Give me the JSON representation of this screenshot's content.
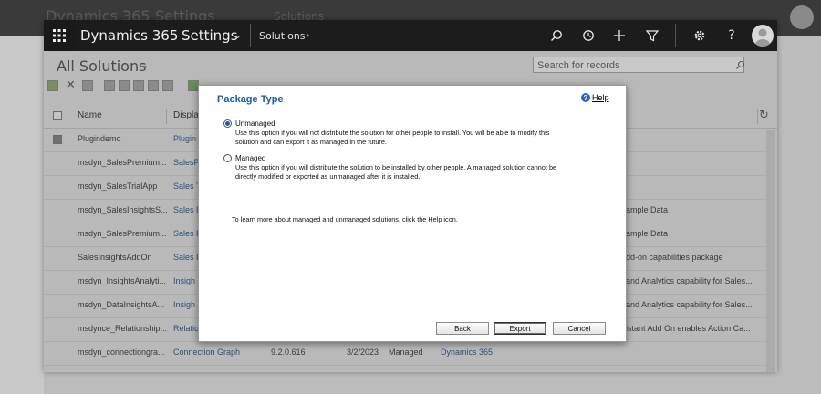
{
  "outer": {
    "title_ghost": "Dynamics 365",
    "settings_ghost": "Settings",
    "crumb_ghost": "Solutions"
  },
  "nav": {
    "brand": "Dynamics 365",
    "settings": "Settings",
    "breadcrumb": "Solutions",
    "colors": {
      "bar": "#1c1c1c",
      "text": "#ffffff"
    }
  },
  "view": {
    "title": "All Solutions",
    "search_placeholder": "Search for records"
  },
  "grid": {
    "headers": {
      "name": "Name",
      "display": "Displa"
    },
    "rows": [
      {
        "name": "Plugindemo",
        "display": "Plugin",
        "extra": ""
      },
      {
        "name": "msdyn_SalesPremium...",
        "display": "SalesP",
        "extra": ""
      },
      {
        "name": "msdyn_SalesTrialApp",
        "display": "Sales T",
        "extra": ""
      },
      {
        "name": "msdyn_SalesInsightsS...",
        "display": "Sales I",
        "extra": "ample Data"
      },
      {
        "name": "msdyn_SalesPremium...",
        "display": "Sales P",
        "extra": "ample Data"
      },
      {
        "name": "SalesInsightsAddOn",
        "display": "Sales I",
        "extra": "dd-on capabilities package"
      },
      {
        "name": "msdyn_InsightsAnalyti...",
        "display": "Insigh",
        "extra": "and Analytics capability for Sales..."
      },
      {
        "name": "msdyn_DataInsightsA...",
        "display": "Insigh",
        "extra": "and Analytics capability for Sales..."
      },
      {
        "name": "msdynce_Relationship...",
        "display": "Relatio",
        "extra": "istant Add On enables Action Ca..."
      },
      {
        "name": "msdyn_connectiongra...",
        "display": "Connection Graph",
        "version": "9.2.0.616",
        "date": "3/2/2023",
        "type": "Managed",
        "publisher": "Dynamics 365",
        "extra": ""
      }
    ]
  },
  "dialog": {
    "title": "Package Type",
    "help": "Help",
    "unmanaged": {
      "label": "Unmanaged",
      "desc1": "Use this option if you will not distribute the solution for other people to install. You will be able to modify this",
      "desc2": "solution and can export it as managed in the future."
    },
    "managed": {
      "label": "Managed",
      "desc1": "Use this option if you will distribute the solution to be installed by other people. A managed solution cannot be",
      "desc2": "directly modified or exported as unmanaged after it is installed."
    },
    "learn_more": "To learn more about managed and unmanaged solutions, click the Help icon.",
    "buttons": {
      "back": "Back",
      "export": "Export",
      "cancel": "Cancel"
    },
    "colors": {
      "title": "#1e5aa8"
    }
  }
}
